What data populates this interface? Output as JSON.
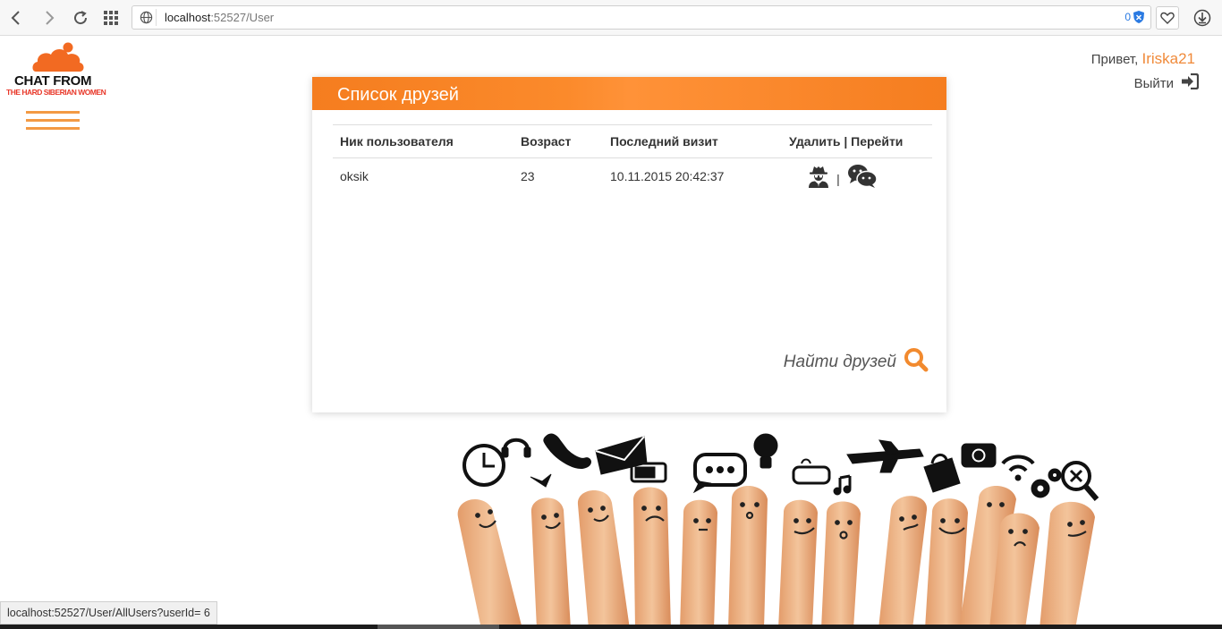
{
  "browser": {
    "url_host": "localhost",
    "url_rest": ":52527/User",
    "shield_count": "0"
  },
  "logo": {
    "line1": "CHAT FROM",
    "line2": "THE HARD SIBERIAN WOMEN"
  },
  "header": {
    "greeting": "Привет,",
    "username": "Iriska21",
    "logout_label": "Выйти"
  },
  "panel": {
    "title": "Список друзей",
    "columns": [
      "Ник пользователя",
      "Возраст",
      "Последний визит",
      "Удалить | Перейти"
    ],
    "rows": [
      {
        "nick": "oksik",
        "age": "23",
        "last_visit": "10.11.2015 20:42:37",
        "separator": "|"
      }
    ],
    "find_friends": "Найти друзей"
  },
  "status_bar": {
    "url": "localhost:52527/User/AllUsers?userId= 6"
  },
  "colors": {
    "accent": "#f57d1f",
    "username": "#f08a3a"
  }
}
